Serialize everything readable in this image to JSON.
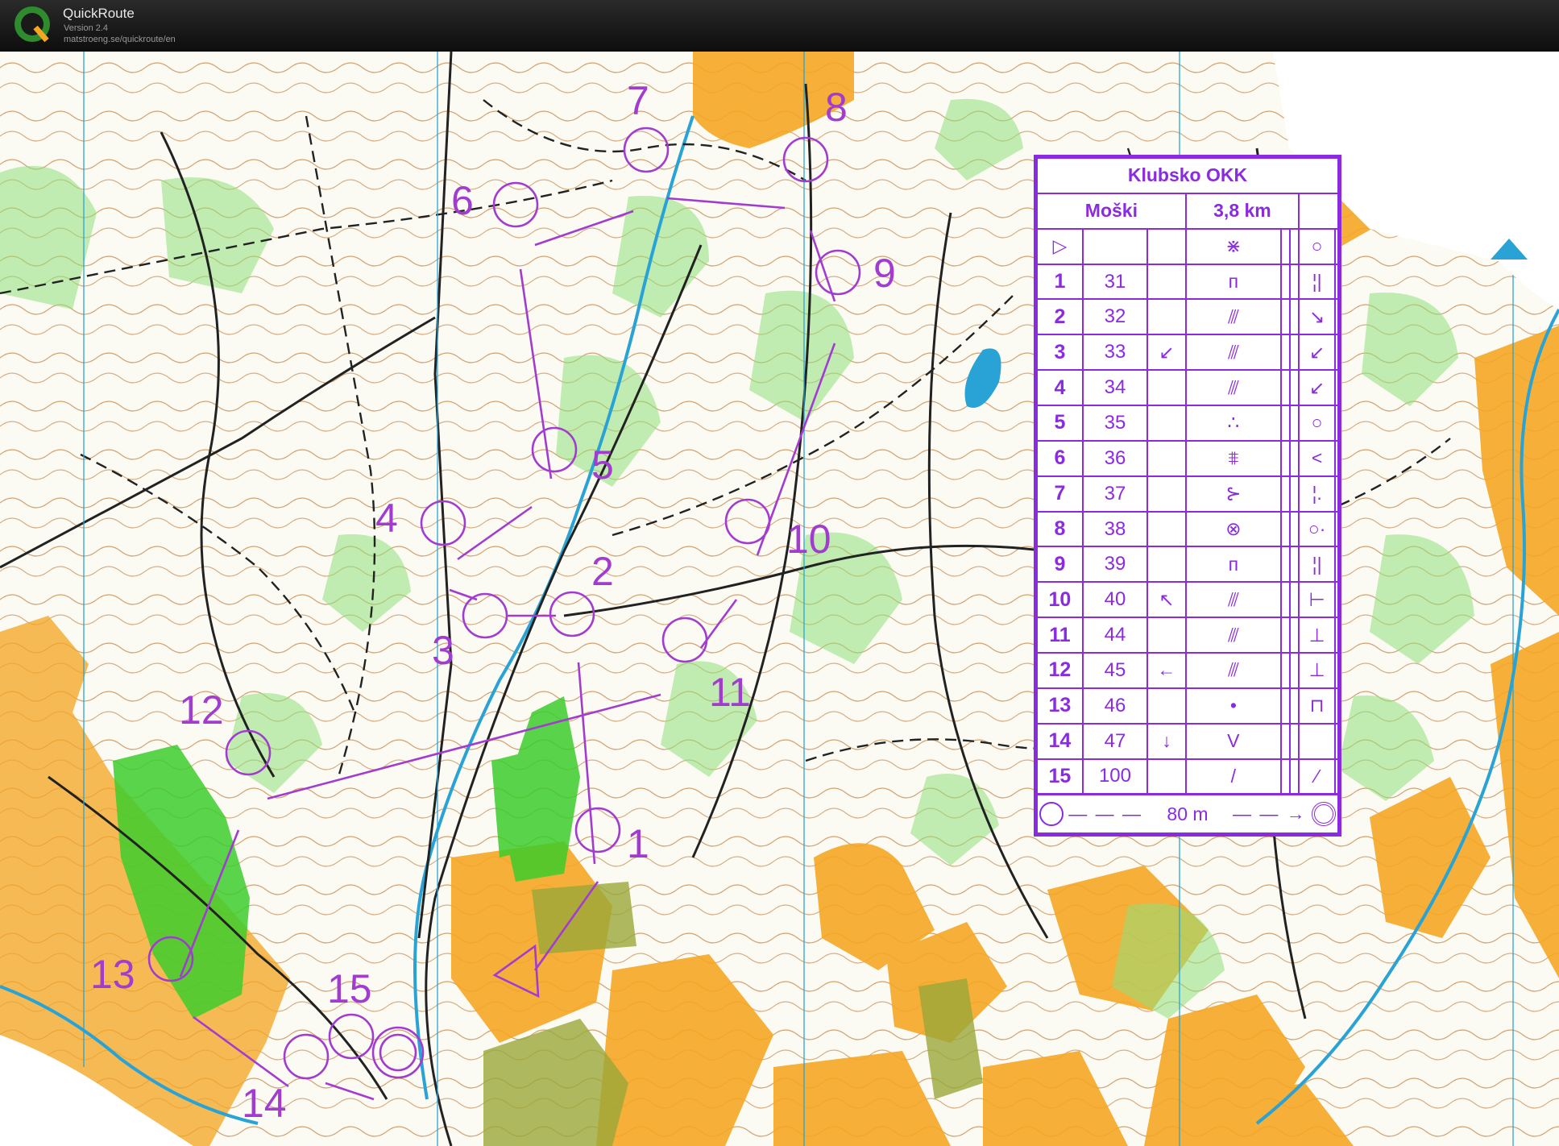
{
  "app": {
    "name": "QuickRoute",
    "version": "Version 2.4",
    "url": "matstroeng.se/quickroute/en",
    "logo_letter": "Q",
    "logo_icon": "quickroute-logo-icon"
  },
  "course": {
    "title": "Klubsko OKK",
    "class_name": "Moški",
    "length": "3,8 km",
    "line_color": "#a23cd0",
    "controls_on_map": [
      "1",
      "2",
      "3",
      "4",
      "5",
      "6",
      "7",
      "8",
      "9",
      "10",
      "11",
      "12",
      "13",
      "14",
      "15"
    ],
    "descriptions": [
      {
        "num": "1",
        "code": "31",
        "dir": "",
        "feature": "ᴨ",
        "detail": "¦|"
      },
      {
        "num": "2",
        "code": "32",
        "dir": "",
        "feature": "⫻",
        "detail": "↘"
      },
      {
        "num": "3",
        "code": "33",
        "dir": "↙",
        "feature": "⫻",
        "detail": "↙"
      },
      {
        "num": "4",
        "code": "34",
        "dir": "",
        "feature": "⫻",
        "detail": "↙"
      },
      {
        "num": "5",
        "code": "35",
        "dir": "",
        "feature": "∴",
        "detail": "○"
      },
      {
        "num": "6",
        "code": "36",
        "dir": "",
        "feature": "⩨",
        "detail": "<"
      },
      {
        "num": "7",
        "code": "37",
        "dir": "",
        "feature": "⊱",
        "detail": "¦."
      },
      {
        "num": "8",
        "code": "38",
        "dir": "",
        "feature": "⊗",
        "detail": "○·"
      },
      {
        "num": "9",
        "code": "39",
        "dir": "",
        "feature": "ᴨ",
        "detail": "¦|"
      },
      {
        "num": "10",
        "code": "40",
        "dir": "↖",
        "feature": "⫻",
        "detail": "⊢"
      },
      {
        "num": "11",
        "code": "44",
        "dir": "",
        "feature": "⫻",
        "detail": "⊥"
      },
      {
        "num": "12",
        "code": "45",
        "dir": "←",
        "feature": "⫻",
        "detail": "⊥"
      },
      {
        "num": "13",
        "code": "46",
        "dir": "",
        "feature": "•",
        "detail": "⊓"
      },
      {
        "num": "14",
        "code": "47",
        "dir": "↓",
        "feature": "V",
        "detail": ""
      },
      {
        "num": "15",
        "code": "100",
        "dir": "",
        "feature": "/",
        "detail": "⁄"
      }
    ],
    "start_symbol": "▷",
    "start_feature": "⋇",
    "start_detail": "○",
    "finish_distance": "80 m"
  },
  "colors": {
    "open_land": "#f5a623",
    "forest_green": "#7ed957",
    "dense_green": "#3dcc2b",
    "contour": "#b5651d",
    "water": "#29a3d6",
    "purple": "#8a2be2"
  }
}
